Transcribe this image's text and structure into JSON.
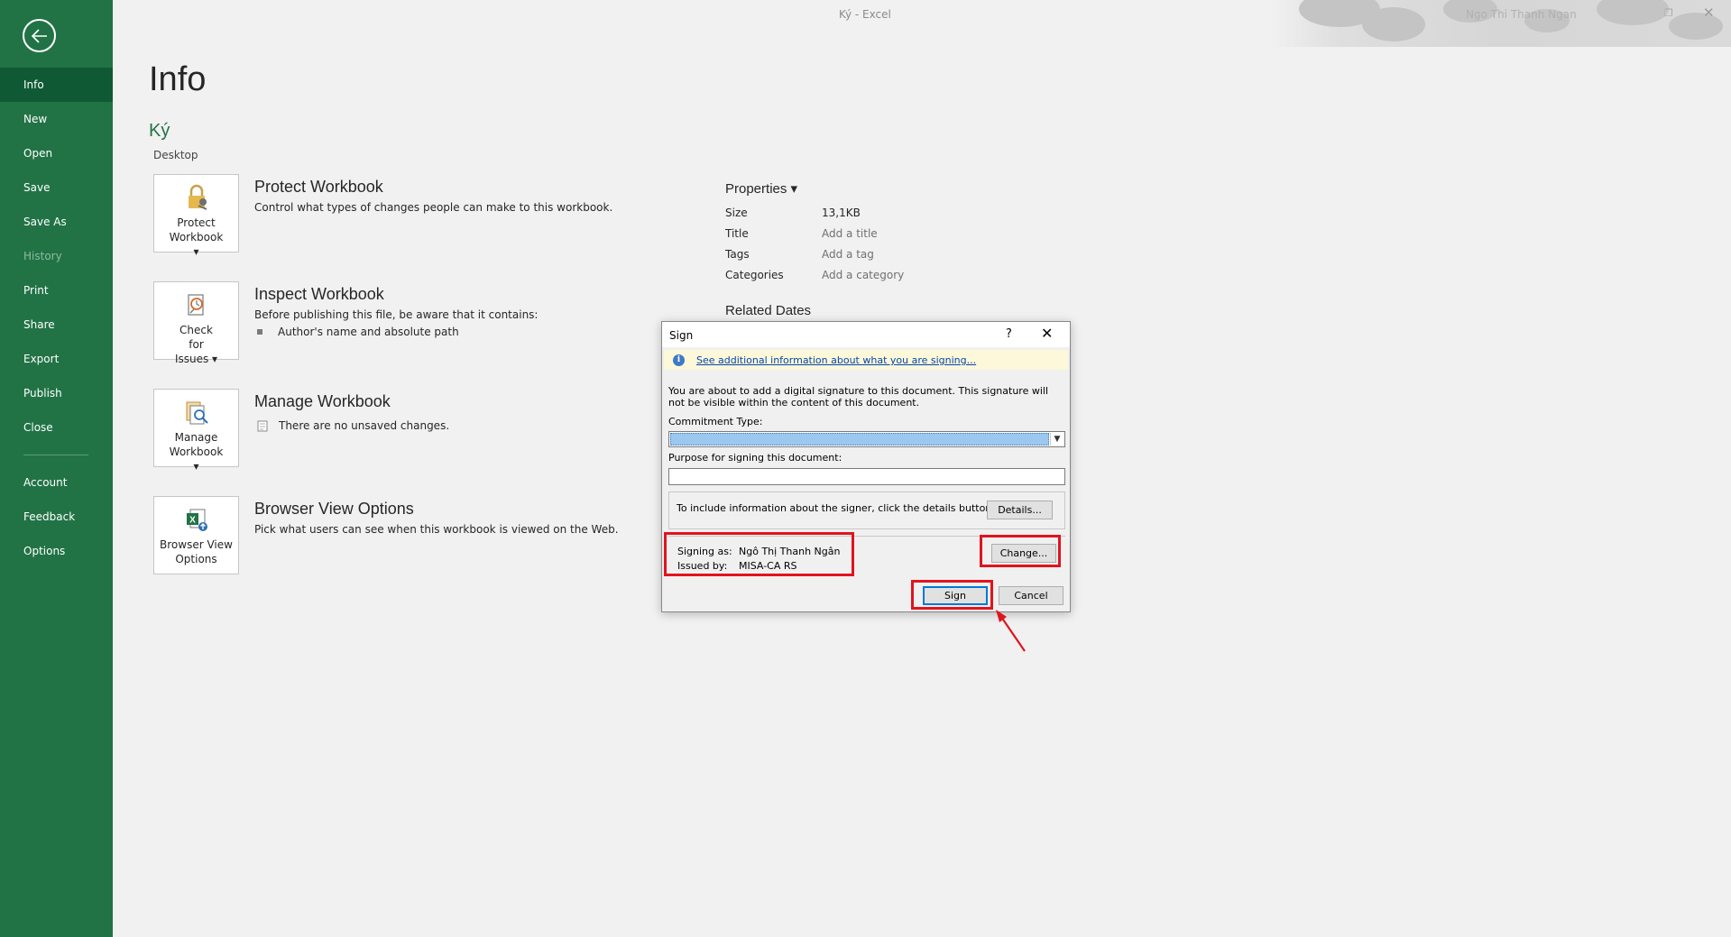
{
  "window": {
    "title": "Ký  -  Excel",
    "user": "Ngo Thi Thanh Ngan",
    "restore_glyph": "❐",
    "close_glyph": "✕"
  },
  "sidebar": {
    "items": [
      {
        "label": "Info"
      },
      {
        "label": "New"
      },
      {
        "label": "Open"
      },
      {
        "label": "Save"
      },
      {
        "label": "Save As"
      },
      {
        "label": "History"
      },
      {
        "label": "Print"
      },
      {
        "label": "Share"
      },
      {
        "label": "Export"
      },
      {
        "label": "Publish"
      },
      {
        "label": "Close"
      },
      {
        "label": "Account"
      },
      {
        "label": "Feedback"
      },
      {
        "label": "Options"
      }
    ]
  },
  "info": {
    "title": "Info",
    "doc_name": "Ký",
    "location": "Desktop",
    "sections": [
      {
        "button_label": "Protect Workbook ▾",
        "title": "Protect Workbook",
        "desc": "Control what types of changes people can make to this workbook."
      },
      {
        "button_label": "Check for Issues ▾",
        "title": "Inspect Workbook",
        "desc": "Before publishing this file, be aware that it contains:",
        "bullet": "Author's name and absolute path"
      },
      {
        "button_label": "Manage Workbook ▾",
        "title": "Manage Workbook",
        "desc": "There are no unsaved changes."
      },
      {
        "button_label": "Browser View Options",
        "title": "Browser View Options",
        "desc": "Pick what users can see when this workbook is viewed on the Web."
      }
    ]
  },
  "properties": {
    "title": "Properties ▾",
    "rows": [
      {
        "key": "Size",
        "value": "13,1KB"
      },
      {
        "key": "Title",
        "value": "Add a title"
      },
      {
        "key": "Tags",
        "value": "Add a tag"
      },
      {
        "key": "Categories",
        "value": "Add a category"
      }
    ],
    "related_title": "Related Dates"
  },
  "dialog": {
    "title": "Sign",
    "help": "?",
    "close": "✕",
    "info_link": "See additional information about what you are signing...",
    "message": "You are about to add a digital signature to this document. This signature will not be visible within the content of this document.",
    "commitment_label": "Commitment Type:",
    "purpose_label": "Purpose for signing this document:",
    "purpose_value": "",
    "details_text": "To include information about the signer, click the details button.",
    "details_button": "Details...",
    "signing_as_label": "Signing as:",
    "signing_as_value": "Ngô Thị Thanh Ngân",
    "issued_by_label": "Issued by:",
    "issued_by_value": "MISA-CA RS",
    "change_button": "Change...",
    "sign_button": "Sign",
    "cancel_button": "Cancel"
  },
  "colors": {
    "accent": "#217346",
    "highlight": "#e0141e"
  }
}
